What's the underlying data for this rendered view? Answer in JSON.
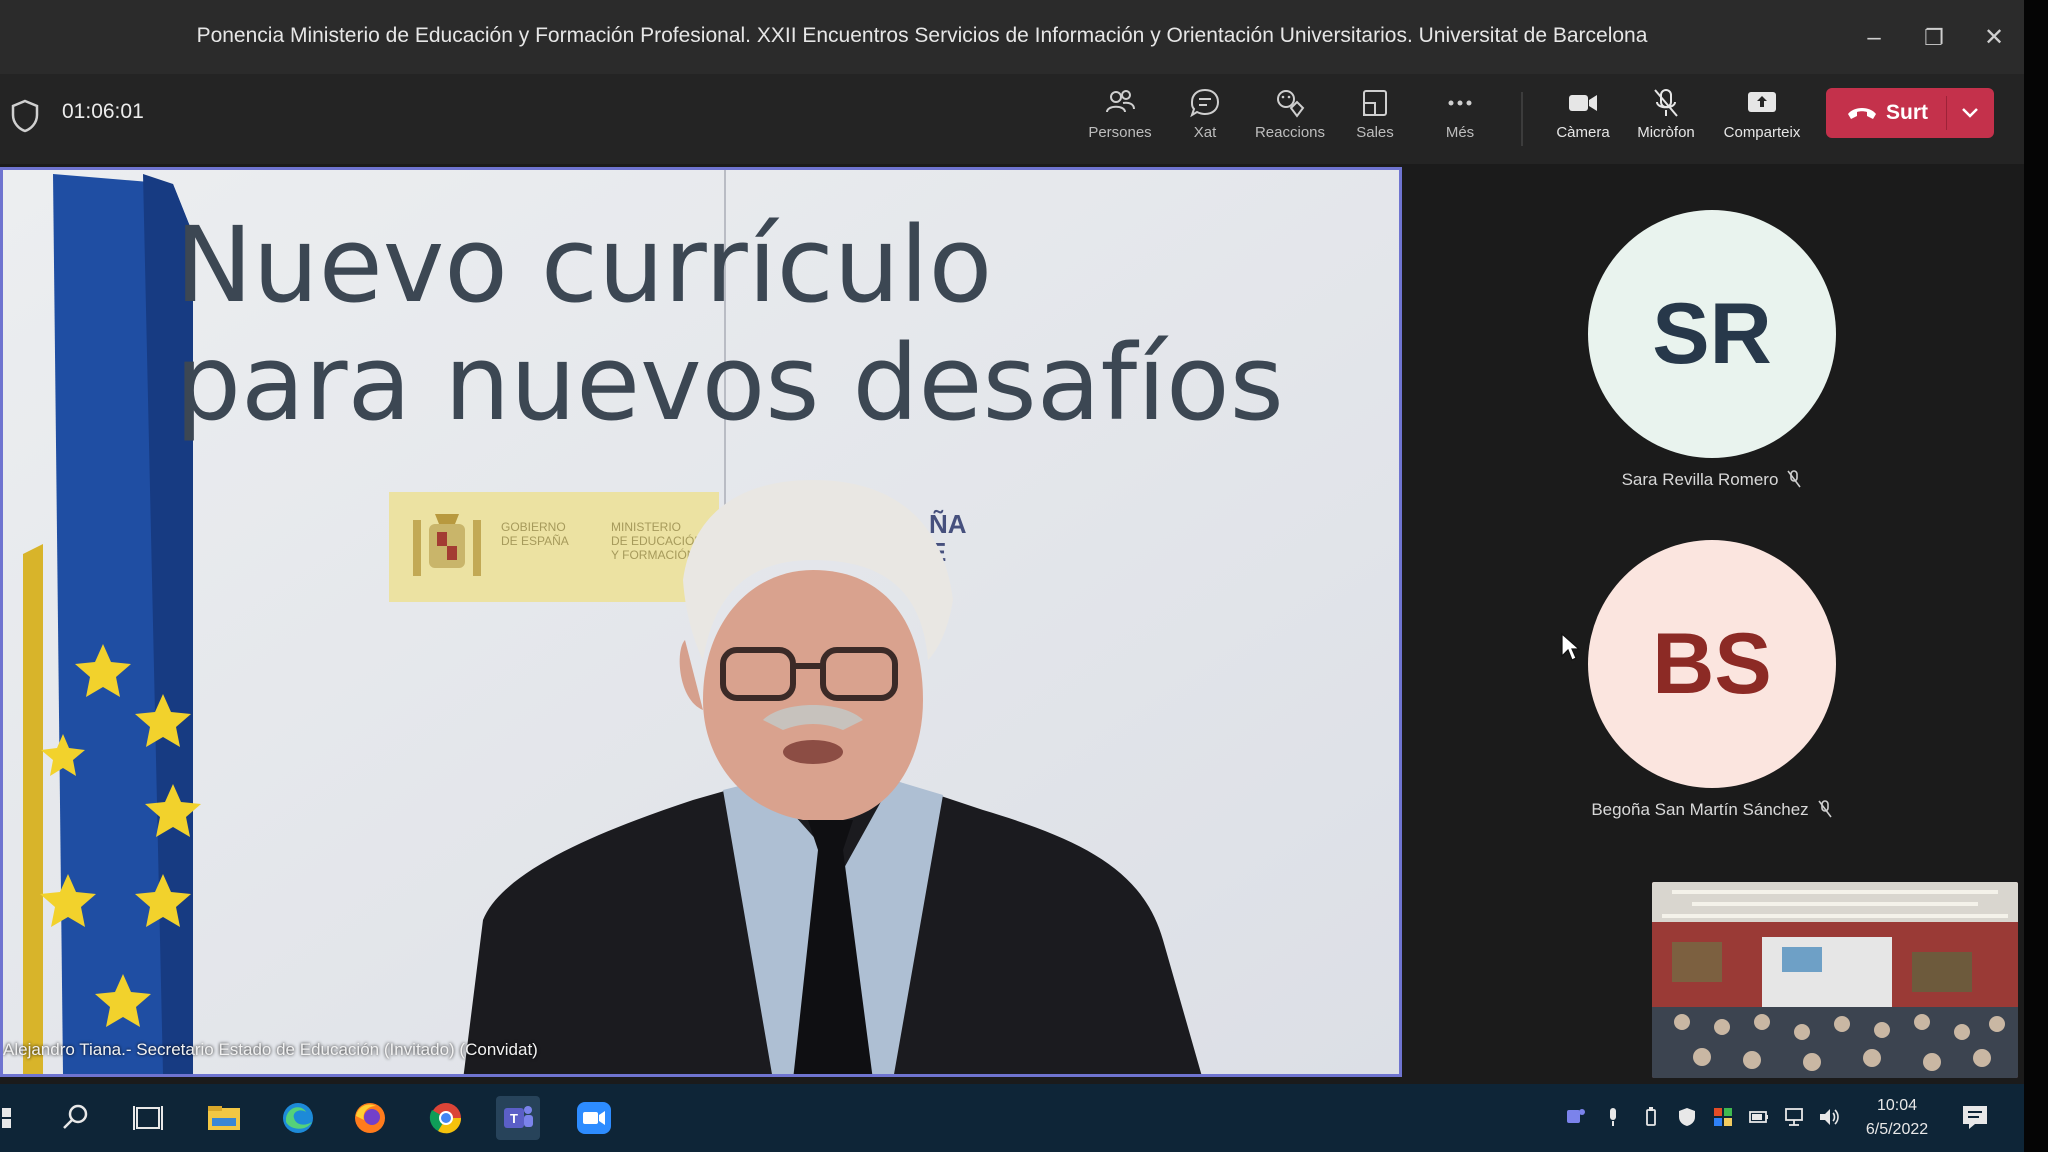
{
  "window": {
    "title": "Ponencia Ministerio de Educación y Formación Profesional. XXII Encuentros Servicios de Información y Orientación Universitarios. Universitat de Barcelona",
    "minimize": "–",
    "restore": "❐",
    "close": "✕"
  },
  "meeting": {
    "timer": "01:06:01"
  },
  "toolbar": {
    "people": "Persones",
    "chat": "Xat",
    "reactions": "Reaccions",
    "rooms": "Sales",
    "more": "Més",
    "camera": "Càmera",
    "mic": "Micròfon",
    "share": "Comparteix",
    "leave": "Surt"
  },
  "main_video": {
    "slide_title_line1": "Nuevo currículo",
    "slide_title_line2": "para nuevos desafíos",
    "gov_text_1a": "GOBIERNO",
    "gov_text_1b": "DE ESPAÑA",
    "gov_text_2a": "MINISTERIO",
    "gov_text_2b": "DE EDUCACIÓN",
    "gov_text_2c": "Y FORMACIÓN",
    "espana_line1": "ÑA",
    "espana_line2": "E",
    "caption": "Alejandro Tiana.- Secretario Estado de Educación (Invitado) (Convidat)"
  },
  "participants": [
    {
      "initials": "SR",
      "name": "Sara Revilla Romero",
      "color": "#e9f3ee"
    },
    {
      "initials": "BS",
      "name": "Begoña San Martín Sánchez",
      "color": "#fbe5df"
    }
  ],
  "taskbar": {
    "time": "10:04",
    "date": "6/5/2022"
  },
  "colors": {
    "leave": "#c4314b",
    "active_speaker_border": "#6f74d0",
    "taskbar": "#0e2537"
  }
}
